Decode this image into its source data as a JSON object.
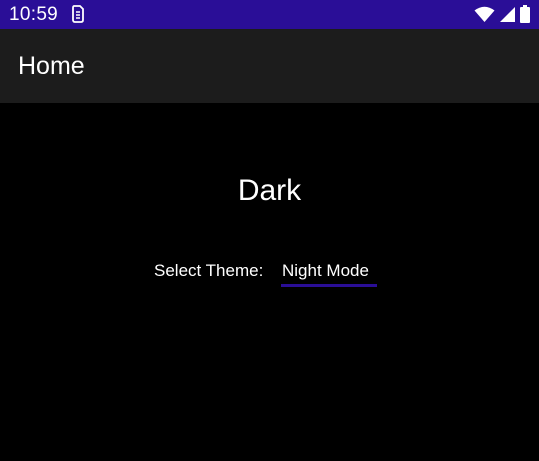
{
  "status_bar": {
    "time": "10:59",
    "notification_icon": "sim-card-icon",
    "icons": [
      "wifi-icon",
      "signal-icon",
      "battery-icon"
    ],
    "background_color": "#2a0e97"
  },
  "app_bar": {
    "title": "Home",
    "background_color": "#1c1c1c"
  },
  "main": {
    "current_theme": "Dark",
    "select_label": "Select Theme:",
    "select_value": "Night Mode",
    "accent_color": "#2a0e97",
    "background_color": "#000000"
  }
}
